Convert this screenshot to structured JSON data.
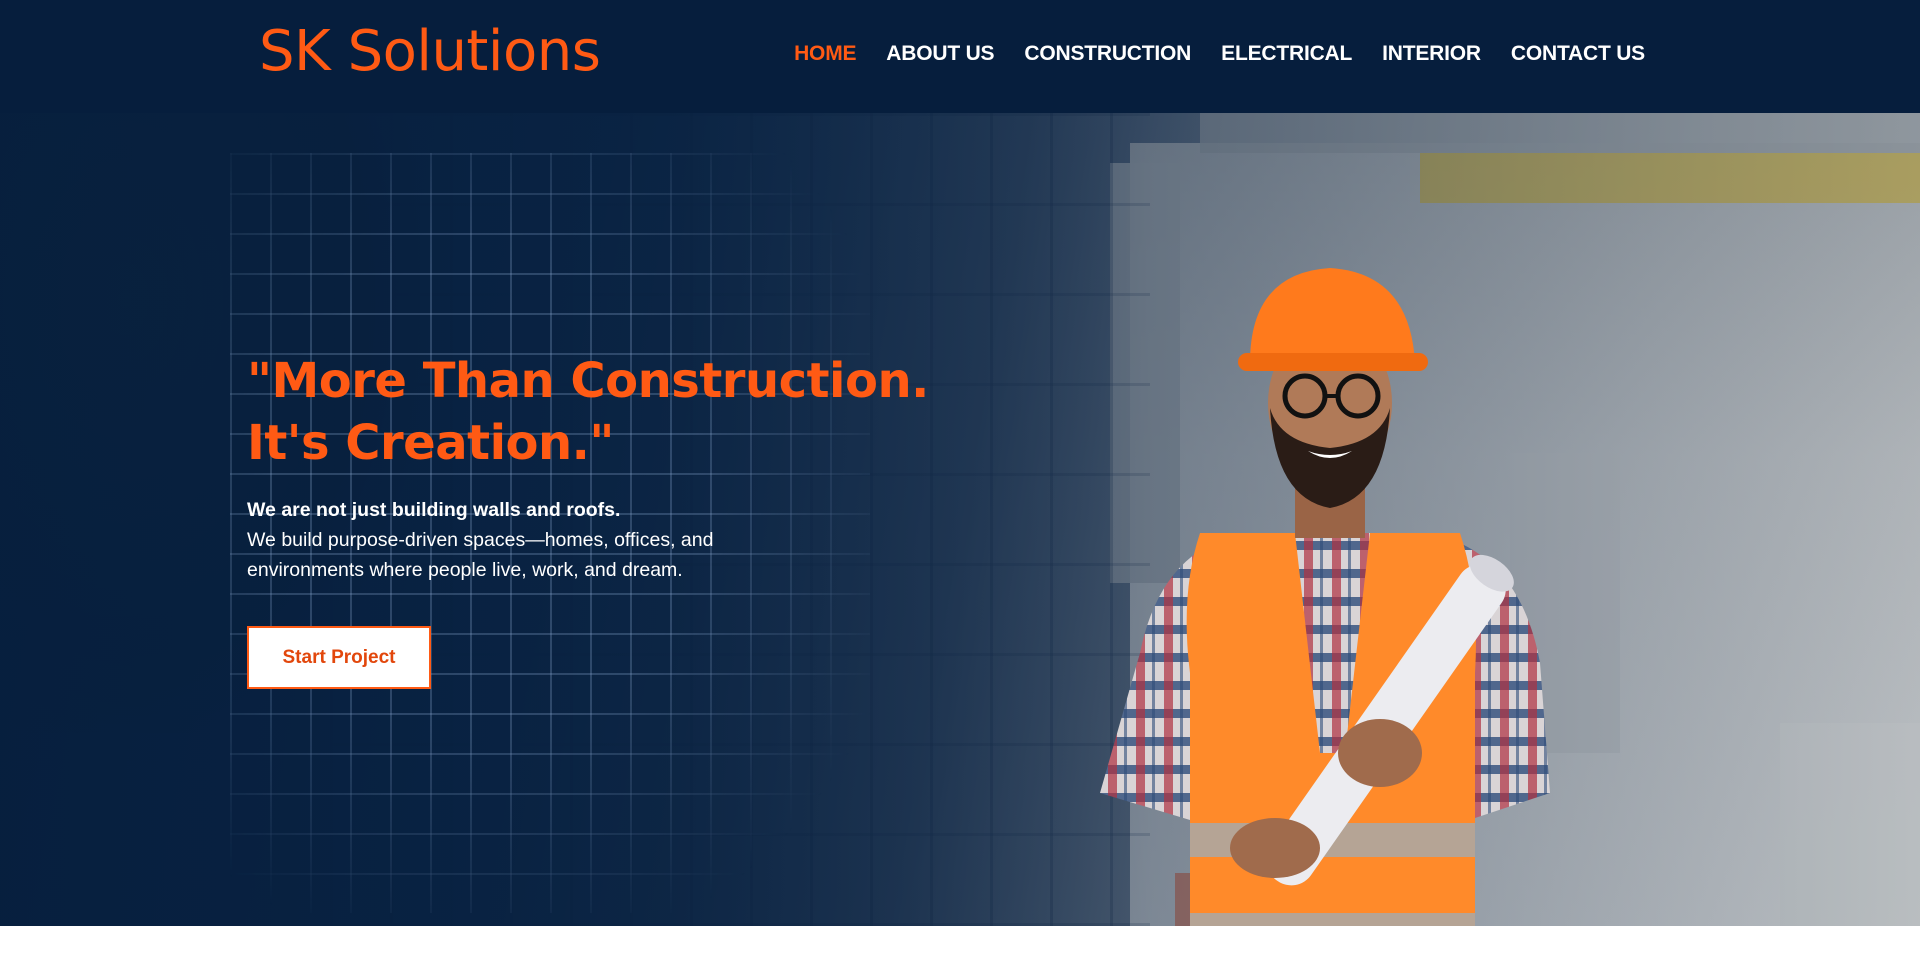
{
  "header": {
    "logo": "SK Solutions",
    "nav": [
      {
        "label": "HOME",
        "active": true
      },
      {
        "label": "ABOUT US",
        "active": false
      },
      {
        "label": "CONSTRUCTION",
        "active": false
      },
      {
        "label": "ELECTRICAL",
        "active": false
      },
      {
        "label": "INTERIOR",
        "active": false
      },
      {
        "label": "CONTACT US",
        "active": false
      }
    ]
  },
  "hero": {
    "headline_line1": "\"More Than Construction.",
    "headline_line2": "It's Creation.\"",
    "subtitle_strong": "We are not just building walls and roofs.",
    "subtitle_text": "We build purpose-driven spaces—homes, offices, and environments where people live, work, and dream.",
    "cta_label": "Start Project",
    "image_subject": "construction-worker-holding-blueprints"
  },
  "colors": {
    "header_bg": "#061e3d",
    "accent": "#ff5a14",
    "text_light": "#ffffff",
    "cta_bg": "#ffffff"
  }
}
